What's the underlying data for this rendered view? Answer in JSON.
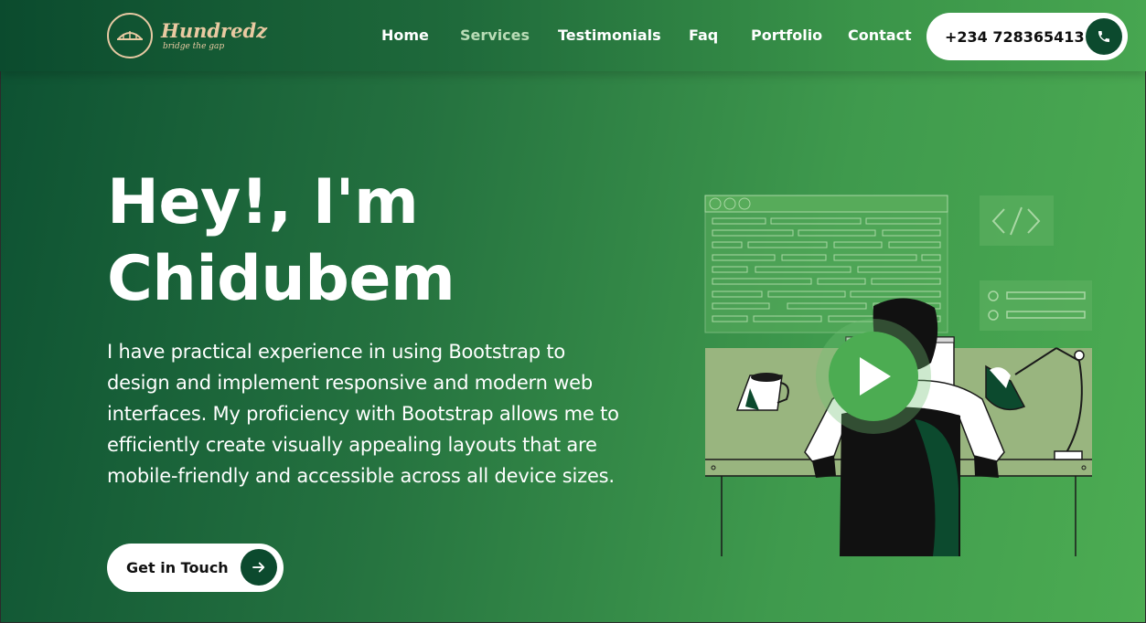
{
  "brand": {
    "name": "Hundredz",
    "tagline": "bridge the gap",
    "logo_icon": "bridge-icon",
    "accent_color": "#e9caa2"
  },
  "nav": {
    "items": [
      {
        "label": "Home",
        "active": false
      },
      {
        "label": "Services",
        "active": true
      },
      {
        "label": "Testimonials",
        "active": false
      },
      {
        "label": "Faq",
        "active": false
      },
      {
        "label": "Portfolio",
        "active": false
      },
      {
        "label": "Contact",
        "active": false
      }
    ]
  },
  "contact": {
    "phone": "+234 728365413",
    "icon": "phone-icon"
  },
  "hero": {
    "title_line1": "Hey!, I'm",
    "title_line2": "Chidubem",
    "description": "I have practical experience in using Bootstrap to design and implement responsive and modern web interfaces. My proficiency with Bootstrap allows me to efficiently create visually appealing layouts that are mobile-friendly and accessible across all device sizes.",
    "cta_label": "Get in Touch",
    "cta_icon": "arrow-right-icon"
  },
  "illustration": {
    "subject": "developer-at-desk",
    "play_icon": "play-icon",
    "code_icon": "code-brackets-icon"
  },
  "colors": {
    "dark_green": "#0c4a2e",
    "mid_green": "#2f8443",
    "light_green": "#4cac52",
    "button_bg": "#ffffff"
  }
}
